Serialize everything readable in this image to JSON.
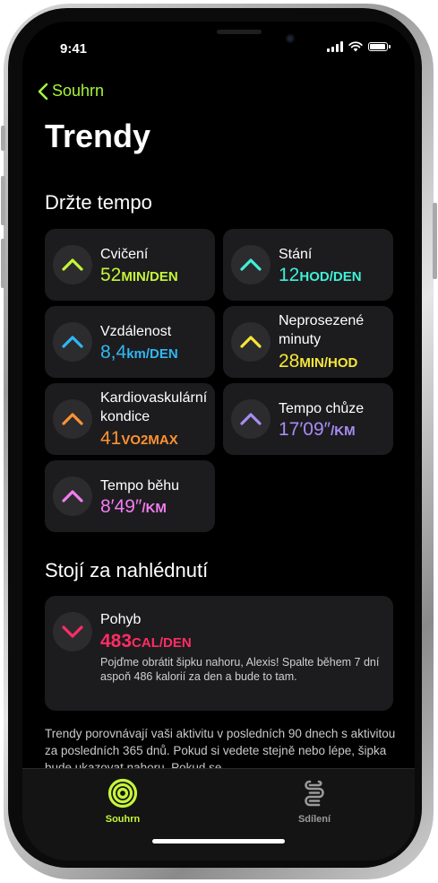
{
  "status_bar": {
    "time": "9:41"
  },
  "nav": {
    "back_label": "Souhrn"
  },
  "page": {
    "title": "Trendy"
  },
  "sections": {
    "pace": "Držte tempo",
    "worth_a_look": "Stojí za nahlédnutí"
  },
  "trends": [
    {
      "label": "Cvičení",
      "value": "52",
      "unit": "MIN/DEN",
      "color": "#c5f53a",
      "direction": "up"
    },
    {
      "label": "Stání",
      "value": "12",
      "unit": "HOD/DEN",
      "color": "#3ff0d8",
      "direction": "up"
    },
    {
      "label": "Vzdálenost",
      "value": "8,4",
      "unit": "km/DEN",
      "color": "#2fb7f5",
      "direction": "up"
    },
    {
      "label": "Neprosezené minuty",
      "value": "28",
      "unit": "MIN/HOD",
      "color": "#f5e63a",
      "direction": "up"
    },
    {
      "label": "Kardiovaskulární kondice",
      "value": "41",
      "unit": "VO2MAX",
      "color": "#ff9232",
      "direction": "up"
    },
    {
      "label": "Tempo chůze",
      "value": "17′09″",
      "unit": "/KM",
      "color": "#a98cf5",
      "direction": "up"
    },
    {
      "label": "Tempo běhu",
      "value": "8′49″",
      "unit": "/KM",
      "color": "#f27df0",
      "direction": "up"
    }
  ],
  "highlight": {
    "label": "Pohyb",
    "value": "483",
    "unit": "CAL/DEN",
    "color": "#ff2d64",
    "direction": "down",
    "description": "Pojďme obrátit šipku nahoru, Alexis! Spalte během 7 dní aspoň 486 kalorií za den a bude to tam."
  },
  "footer_text": "Trendy porovnávají vaši aktivitu v posledních 90 dnech s aktivitou za posledních 365 dnů. Pokud si vedete stejně nebo lépe, šipka bude ukazovat nahoru. Pokud se",
  "tabbar": {
    "tabs": [
      {
        "label": "Souhrn",
        "icon": "activity-rings-icon",
        "active": true,
        "color": "#c5f53a"
      },
      {
        "label": "Sdílení",
        "icon": "sharing-icon",
        "active": false,
        "color": "#9a9a9a"
      }
    ]
  }
}
